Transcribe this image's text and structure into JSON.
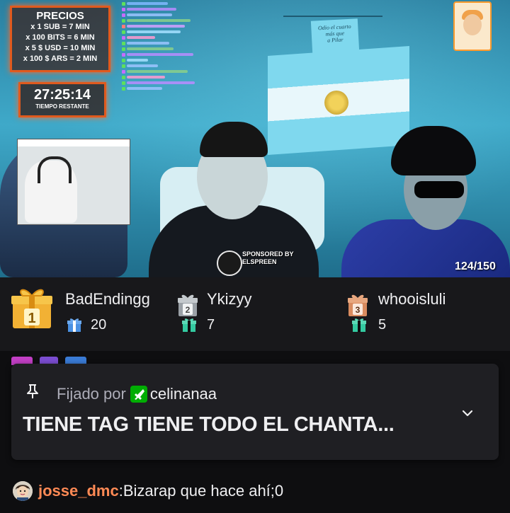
{
  "overlay": {
    "prices": {
      "title": "PRECIOS",
      "lines": [
        "x 1 SUB = 7 MIN",
        "x 100 BITS = 6 MIN",
        "x 5 $ USD = 10 MIN",
        "x 100 $ ARS = 2 MIN"
      ]
    },
    "timer": {
      "value": "27:25:14",
      "label": "TIEMPO RESTANTE"
    },
    "sponsor": {
      "line1": "SPONSORED BY",
      "line2": "ELSPREEN"
    },
    "viewer_count": "124/150",
    "colors": {
      "accent": "#e05a1e",
      "glow": "#ff6a2a"
    }
  },
  "leaderboard": [
    {
      "rank": "1",
      "name": "BadEndingg",
      "gifts": "20",
      "icon": "gift-icon",
      "color": "#f2b134"
    },
    {
      "rank": "2",
      "name": "Ykizyy",
      "gifts": "7",
      "icon": "gift-icon",
      "color": "#9aa0a6"
    },
    {
      "rank": "3",
      "name": "whooisluli",
      "gifts": "5",
      "icon": "gift-icon",
      "color": "#d98b5f"
    }
  ],
  "pinned": {
    "label": "Fijado por",
    "user": "celinanaa",
    "message": "TIENE TAG TIENE TODO EL CHANTA...",
    "pin_icon": "pin-icon",
    "expand_icon": "chevron-down-icon"
  },
  "chat": [
    {
      "user": "josse_dmc",
      "separator": ":",
      "text": " Bizarap que hace ahí;0",
      "user_color": "#ff8a55"
    }
  ],
  "colors": {
    "background": "#0e0e10",
    "panel": "#18181b",
    "pinned_bg": "#1f1f23",
    "text": "#efeff1",
    "muted": "#adadb8",
    "moderator": "#00ad03",
    "gift_teal": "#33c9a0",
    "gift_blue": "#4a90e2"
  }
}
